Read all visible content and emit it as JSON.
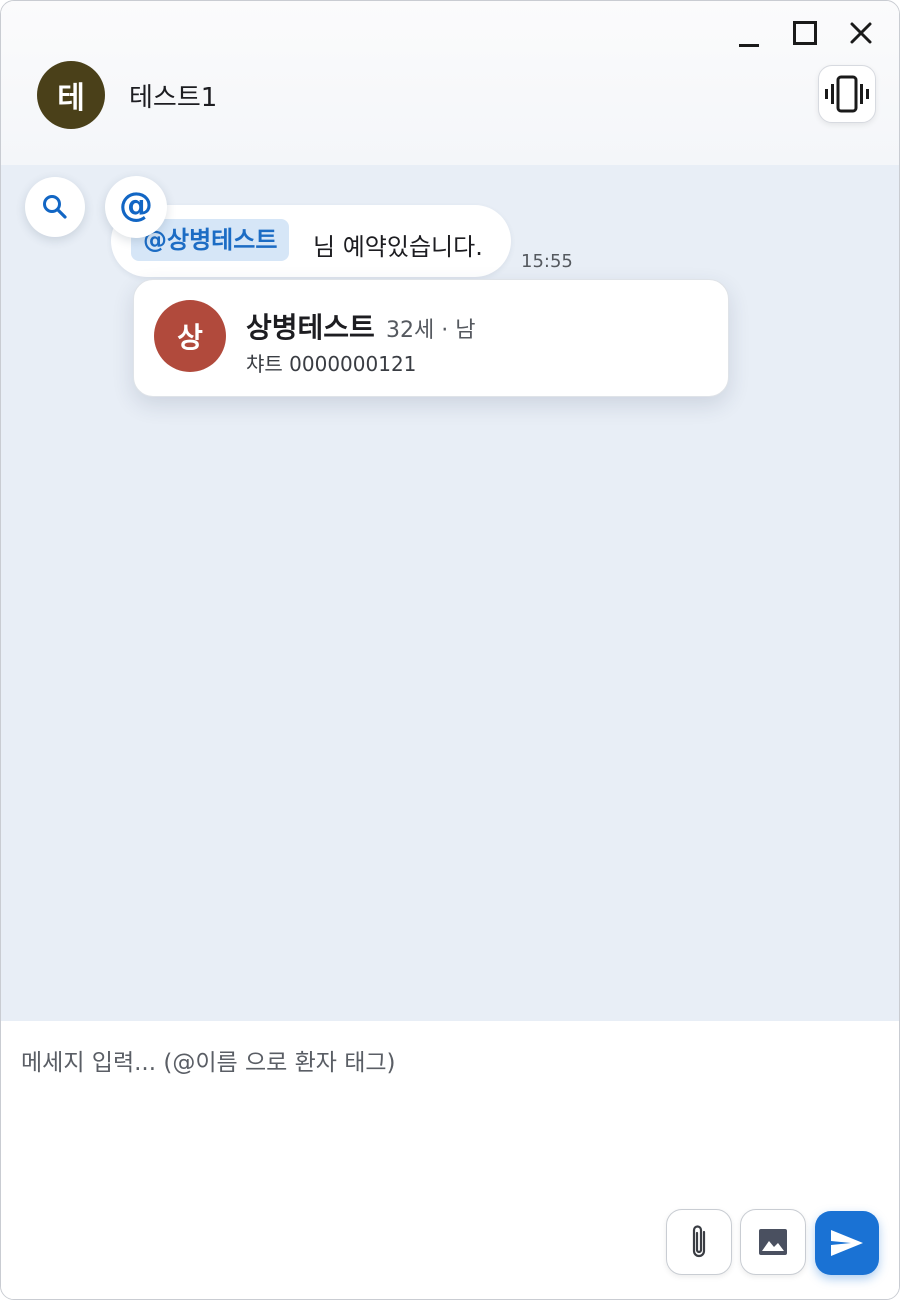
{
  "header": {
    "avatar_initial": "테",
    "title": "테스트1",
    "avatar_color": "#4a4019"
  },
  "window_controls": [
    "minimize",
    "maximize",
    "close"
  ],
  "chat": {
    "background": "#e8eef6",
    "floating_buttons": {
      "search_icon": "search-icon",
      "mention_symbol": "@"
    },
    "messages": [
      {
        "mention": "@상병테스트",
        "text": "님 예약있습니다.",
        "time": "15:55"
      }
    ],
    "patient_card": {
      "initial": "상",
      "name": "상병테스트",
      "meta": "32세 · 남",
      "chart": "챠트 0000000121",
      "avatar_color": "#b14a3c"
    }
  },
  "composer": {
    "placeholder": "메세지 입력... (@이름 으로 환자 태그)",
    "value": "",
    "buttons": [
      "paperclip-icon",
      "image-icon",
      "send-icon"
    ],
    "send_color": "#1a72d4"
  }
}
